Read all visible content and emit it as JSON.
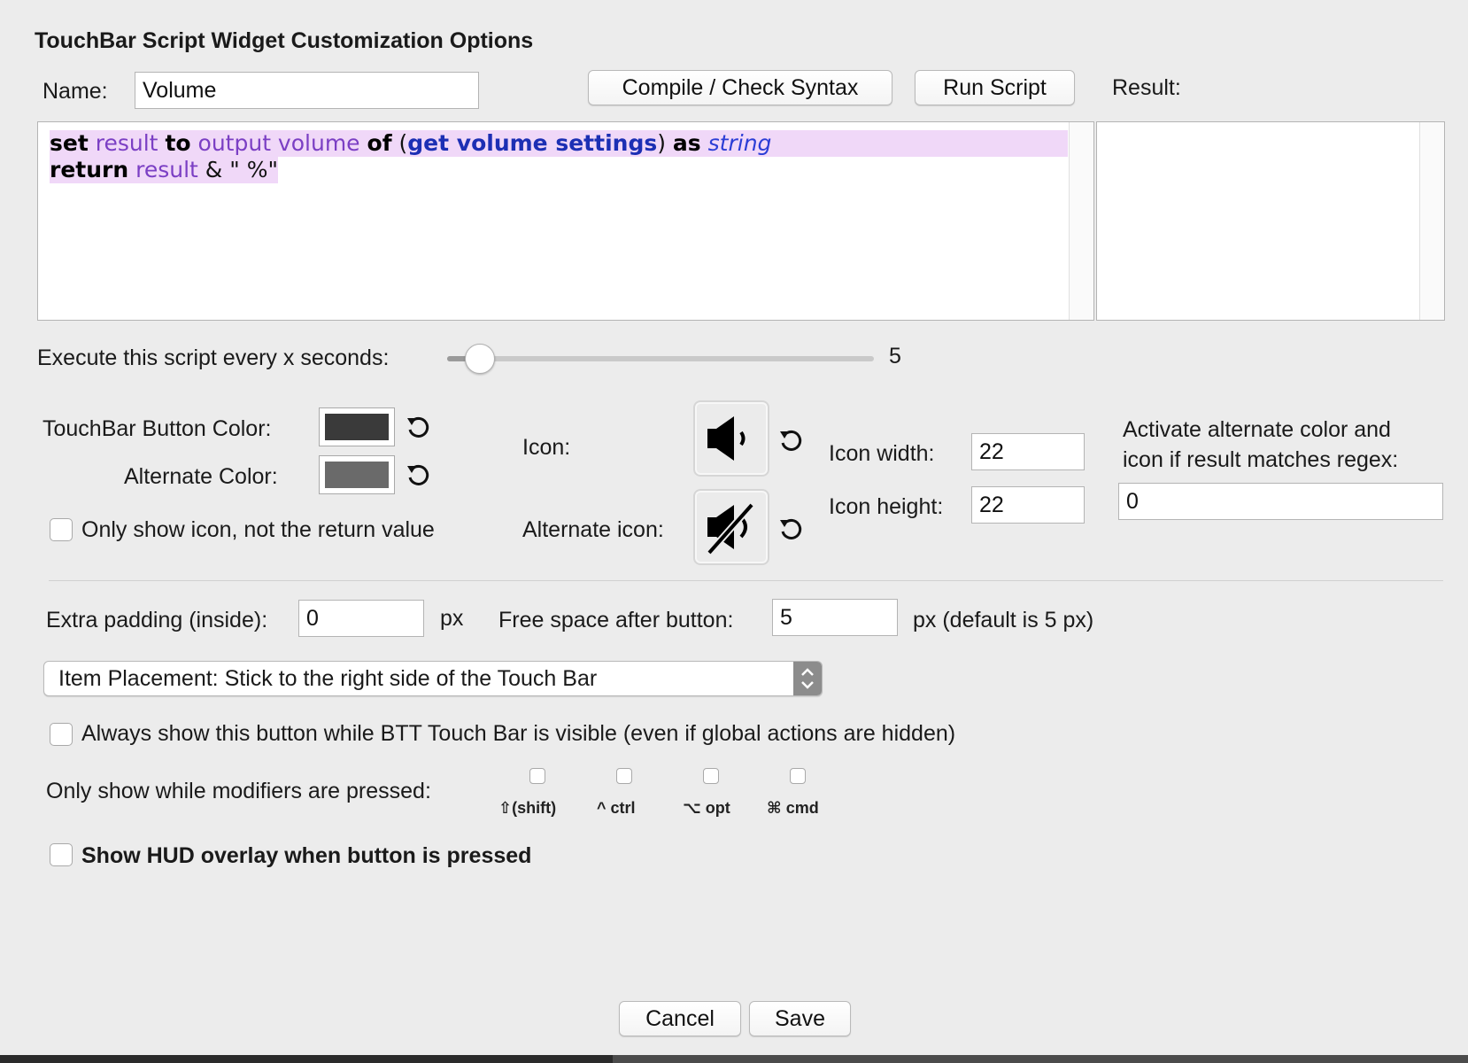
{
  "title": "TouchBar Script Widget Customization Options",
  "name": {
    "label": "Name:",
    "value": "Volume"
  },
  "buttons": {
    "compile": "Compile / Check Syntax",
    "run": "Run Script",
    "cancel": "Cancel",
    "save": "Save"
  },
  "result": {
    "label": "Result:",
    "value": ""
  },
  "script": {
    "line1": [
      {
        "t": "set",
        "c": "kw"
      },
      {
        "t": " ",
        "c": "plain"
      },
      {
        "t": "result",
        "c": "var"
      },
      {
        "t": " ",
        "c": "plain"
      },
      {
        "t": "to",
        "c": "kw"
      },
      {
        "t": " ",
        "c": "plain"
      },
      {
        "t": "output volume",
        "c": "var"
      },
      {
        "t": " ",
        "c": "plain"
      },
      {
        "t": "of",
        "c": "kw"
      },
      {
        "t": " (",
        "c": "plain"
      },
      {
        "t": "get volume settings",
        "c": "cmd"
      },
      {
        "t": ") ",
        "c": "plain"
      },
      {
        "t": "as",
        "c": "kw"
      },
      {
        "t": " ",
        "c": "plain"
      },
      {
        "t": "string",
        "c": "cls"
      }
    ],
    "line2": [
      {
        "t": "return",
        "c": "kw"
      },
      {
        "t": " ",
        "c": "plain"
      },
      {
        "t": "result",
        "c": "var"
      },
      {
        "t": " & \" %\"",
        "c": "plain"
      }
    ]
  },
  "interval": {
    "label": "Execute this script every x seconds:",
    "value": "5",
    "fraction": 0.04
  },
  "colors": {
    "button_label": "TouchBar Button Color:",
    "button_color": "#3a3a3a",
    "alternate_label": "Alternate Color:",
    "alternate_color": "#6a6a6a"
  },
  "only_icon": {
    "label": "Only show icon, not the return value",
    "checked": false
  },
  "icon": {
    "label": "Icon:",
    "icon_name": "speaker-volume-icon"
  },
  "alt_icon": {
    "label": "Alternate icon:",
    "icon_name": "speaker-muted-icon"
  },
  "icon_width": {
    "label": "Icon width:",
    "value": "22"
  },
  "icon_height": {
    "label": "Icon height:",
    "value": "22"
  },
  "regex": {
    "label_line1": "Activate alternate color and",
    "label_line2": "icon if result matches regex:",
    "value": "0"
  },
  "padding": {
    "label": "Extra padding (inside):",
    "value": "0",
    "unit": "px"
  },
  "free_space": {
    "label": "Free space after button:",
    "value": "5",
    "unit": "px (default is 5 px)"
  },
  "placement": {
    "selected": "Item Placement: Stick to the right side of the Touch Bar"
  },
  "always_show": {
    "label": "Always show this button while BTT Touch Bar is visible (even if global actions are hidden)",
    "checked": false
  },
  "modifiers": {
    "label": "Only show while modifiers are pressed:",
    "shift": "⇧(shift)",
    "ctrl": "^ ctrl",
    "opt": "⌥ opt",
    "cmd": "⌘ cmd"
  },
  "hud": {
    "label": "Show HUD overlay when button is pressed",
    "checked": false
  }
}
